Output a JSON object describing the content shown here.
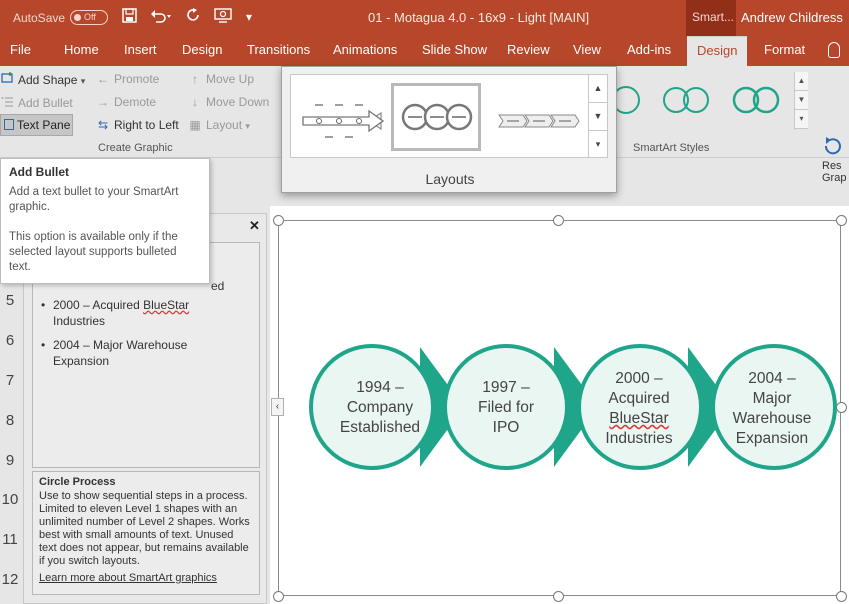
{
  "titlebar": {
    "autosave_label": "AutoSave",
    "autosave_state": "Off",
    "doc_title": "01 - Motagua 4.0 - 16x9 - Light [MAIN]",
    "context_title": "Smart...",
    "user": "Andrew Childress"
  },
  "tabs": [
    {
      "label": "File"
    },
    {
      "label": "Home"
    },
    {
      "label": "Insert"
    },
    {
      "label": "Design"
    },
    {
      "label": "Transitions"
    },
    {
      "label": "Animations"
    },
    {
      "label": "Slide Show"
    },
    {
      "label": "Review"
    },
    {
      "label": "View"
    },
    {
      "label": "Add-ins"
    },
    {
      "label": "Design"
    },
    {
      "label": "Format"
    }
  ],
  "ribbon": {
    "add_shape": "Add Shape",
    "add_bullet": "Add Bullet",
    "text_pane": "Text Pane",
    "promote": "Promote",
    "demote": "Demote",
    "right_to_left": "Right to Left",
    "move_up": "Move Up",
    "move_down": "Move Down",
    "layout": "Layout",
    "create_graphic_label": "Create Graphic",
    "smartart_styles_label": "SmartArt Styles",
    "reset_label_1": "Res",
    "reset_label_2": "Grap"
  },
  "layouts_panel": {
    "label": "Layouts",
    "options": [
      "arrow-timeline",
      "circle-process",
      "chevron-process"
    ],
    "selected": "circle-process"
  },
  "tooltip": {
    "title": "Add Bullet",
    "line1": "Add a text bullet to your SmartArt graphic.",
    "line2": "This option is available only if the selected layout supports bulleted text."
  },
  "slide_numbers": [
    "5",
    "6",
    "7",
    "8",
    "9",
    "10",
    "11",
    "12"
  ],
  "text_pane": {
    "close": "✕",
    "cut_text": "ed",
    "bullets": [
      {
        "year": "2000",
        "dash": " – ",
        "pre": "Acquired ",
        "squig": "BlueStar",
        "post": " Industries"
      },
      {
        "year": "2004",
        "dash": " – ",
        "pre": "Major Warehouse Expansion",
        "squig": "",
        "post": ""
      }
    ],
    "info_title": "Circle Process",
    "info_desc": "Use to show sequential steps in a process. Limited to eleven Level 1 shapes with an unlimited number of Level 2 shapes. Works best with small amounts of text. Unused text does not appear, but remains available if you switch layouts.",
    "info_link": "Learn more about SmartArt graphics"
  },
  "diagram": {
    "color_stroke": "#1fa58a",
    "color_fill": "#e9f6f2",
    "steps": [
      {
        "l1": "1994 –",
        "l2": "Company",
        "l3": "Established",
        "l4": ""
      },
      {
        "l1": "1997 –",
        "l2": "Filed for",
        "l3": "IPO",
        "l4": ""
      },
      {
        "l1": "2000 –",
        "l2": "Acquired",
        "l3": "BlueStar",
        "l4": "Industries"
      },
      {
        "l1": "2004 –",
        "l2": "Major",
        "l3": "Warehouse",
        "l4": "Expansion"
      }
    ]
  }
}
